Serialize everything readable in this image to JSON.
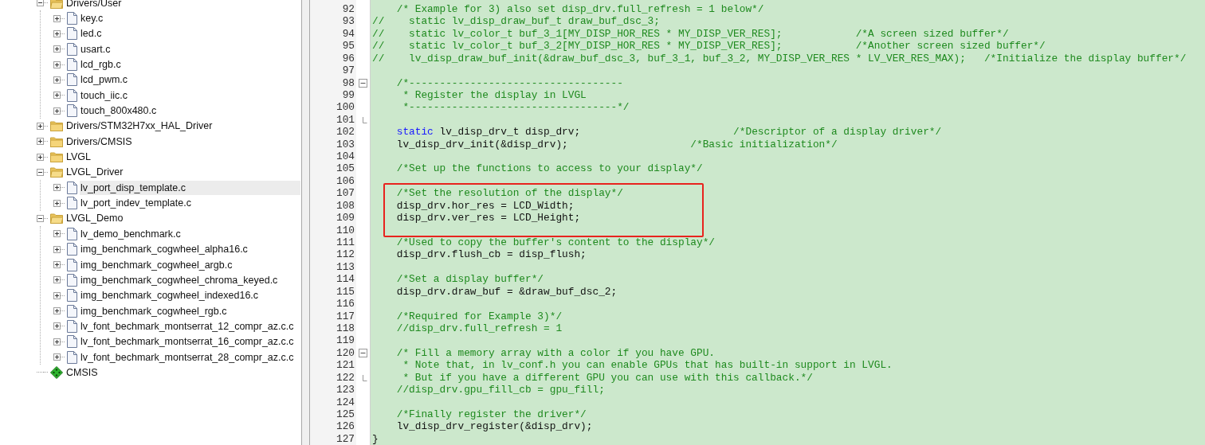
{
  "project_tree": {
    "items": [
      {
        "label": "Drivers/User",
        "kind": "folder",
        "expanded": true,
        "selected": false,
        "children": [
          {
            "label": "key.c",
            "kind": "file",
            "expanded": false,
            "selected": false
          },
          {
            "label": "led.c",
            "kind": "file",
            "expanded": false,
            "selected": false
          },
          {
            "label": "usart.c",
            "kind": "file",
            "expanded": false,
            "selected": false
          },
          {
            "label": "lcd_rgb.c",
            "kind": "file",
            "expanded": false,
            "selected": false
          },
          {
            "label": "lcd_pwm.c",
            "kind": "file",
            "expanded": false,
            "selected": false
          },
          {
            "label": "touch_iic.c",
            "kind": "file",
            "expanded": false,
            "selected": false
          },
          {
            "label": "touch_800x480.c",
            "kind": "file",
            "expanded": false,
            "selected": false
          }
        ]
      },
      {
        "label": "Drivers/STM32H7xx_HAL_Driver",
        "kind": "folder",
        "expanded": false,
        "selected": false
      },
      {
        "label": "Drivers/CMSIS",
        "kind": "folder",
        "expanded": false,
        "selected": false
      },
      {
        "label": "LVGL",
        "kind": "folder",
        "expanded": false,
        "selected": false
      },
      {
        "label": "LVGL_Driver",
        "kind": "folder",
        "expanded": true,
        "selected": false,
        "children": [
          {
            "label": "lv_port_disp_template.c",
            "kind": "file",
            "expanded": false,
            "selected": true
          },
          {
            "label": "lv_port_indev_template.c",
            "kind": "file",
            "expanded": false,
            "selected": false
          }
        ]
      },
      {
        "label": "LVGL_Demo",
        "kind": "folder",
        "expanded": true,
        "selected": false,
        "children": [
          {
            "label": "lv_demo_benchmark.c",
            "kind": "file",
            "expanded": false,
            "selected": false
          },
          {
            "label": "img_benchmark_cogwheel_alpha16.c",
            "kind": "file",
            "expanded": false,
            "selected": false
          },
          {
            "label": "img_benchmark_cogwheel_argb.c",
            "kind": "file",
            "expanded": false,
            "selected": false
          },
          {
            "label": "img_benchmark_cogwheel_chroma_keyed.c",
            "kind": "file",
            "expanded": false,
            "selected": false
          },
          {
            "label": "img_benchmark_cogwheel_indexed16.c",
            "kind": "file",
            "expanded": false,
            "selected": false
          },
          {
            "label": "img_benchmark_cogwheel_rgb.c",
            "kind": "file",
            "expanded": false,
            "selected": false
          },
          {
            "label": "lv_font_bechmark_montserrat_12_compr_az.c.c",
            "kind": "file",
            "expanded": false,
            "selected": false
          },
          {
            "label": "lv_font_bechmark_montserrat_16_compr_az.c.c",
            "kind": "file",
            "expanded": false,
            "selected": false
          },
          {
            "label": "lv_font_bechmark_montserrat_28_compr_az.c.c",
            "kind": "file",
            "expanded": false,
            "selected": false
          }
        ]
      },
      {
        "label": "CMSIS",
        "kind": "component",
        "selected": false
      }
    ]
  },
  "editor": {
    "lines": [
      {
        "number": "92",
        "segments": [
          {
            "kind": "comment",
            "text": "    /* Example for 3) also set disp_drv.full_refresh = 1 below*/"
          }
        ]
      },
      {
        "number": "93",
        "segments": [
          {
            "kind": "comment",
            "text": "//    static lv_disp_draw_buf_t draw_buf_dsc_3;"
          }
        ]
      },
      {
        "number": "94",
        "segments": [
          {
            "kind": "comment",
            "text": "//    static lv_color_t buf_3_1[MY_DISP_HOR_RES * MY_DISP_VER_RES];            /*A screen sized buffer*/"
          }
        ]
      },
      {
        "number": "95",
        "segments": [
          {
            "kind": "comment",
            "text": "//    static lv_color_t buf_3_2[MY_DISP_HOR_RES * MY_DISP_VER_RES];            /*Another screen sized buffer*/"
          }
        ]
      },
      {
        "number": "96",
        "segments": [
          {
            "kind": "comment",
            "text": "//    lv_disp_draw_buf_init(&draw_buf_dsc_3, buf_3_1, buf_3_2, MY_DISP_VER_RES * LV_VER_RES_MAX);   /*Initialize the display buffer*/"
          }
        ]
      },
      {
        "number": "97"
      },
      {
        "number": "98",
        "kind": "fold_start",
        "segments": [
          {
            "kind": "comment",
            "text": "    /*-----------------------------------"
          }
        ]
      },
      {
        "number": "99",
        "segments": [
          {
            "kind": "comment",
            "text": "     * Register the display in LVGL"
          }
        ]
      },
      {
        "number": "100",
        "segments": [
          {
            "kind": "comment",
            "text": "     *----------------------------------*/"
          }
        ]
      },
      {
        "number": "101",
        "kind": "fold_end"
      },
      {
        "number": "102",
        "segments": [
          {
            "kind": "keyword",
            "text": "    static"
          },
          {
            "kind": "code",
            "text": " lv_disp_drv_t disp_drv;                         "
          },
          {
            "kind": "comment",
            "text": "/*Descriptor of a display driver*/"
          }
        ]
      },
      {
        "number": "103",
        "segments": [
          {
            "kind": "code",
            "text": "    lv_disp_drv_init(&disp_drv);                    "
          },
          {
            "kind": "comment",
            "text": "/*Basic initialization*/"
          }
        ]
      },
      {
        "number": "104"
      },
      {
        "number": "105",
        "segments": [
          {
            "kind": "comment",
            "text": "    /*Set up the functions to access to your display*/"
          }
        ]
      },
      {
        "number": "106"
      },
      {
        "number": "107",
        "highlighted": true,
        "segments": [
          {
            "kind": "comment",
            "text": "    /*Set the resolution of the display*/"
          }
        ]
      },
      {
        "number": "108",
        "highlighted": true,
        "segments": [
          {
            "kind": "code",
            "text": "    disp_drv.hor_res = LCD_Width;"
          }
        ]
      },
      {
        "number": "109",
        "highlighted": true,
        "segments": [
          {
            "kind": "code",
            "text": "    disp_drv.ver_res = LCD_Height;"
          }
        ]
      },
      {
        "number": "110",
        "highlighted": true
      },
      {
        "number": "111",
        "segments": [
          {
            "kind": "comment",
            "text": "    /*Used to copy the buffer's content to the display*/"
          }
        ]
      },
      {
        "number": "112",
        "segments": [
          {
            "kind": "code",
            "text": "    disp_drv.flush_cb = disp_flush;"
          }
        ]
      },
      {
        "number": "113"
      },
      {
        "number": "114",
        "segments": [
          {
            "kind": "comment",
            "text": "    /*Set a display buffer*/"
          }
        ]
      },
      {
        "number": "115",
        "segments": [
          {
            "kind": "code",
            "text": "    disp_drv.draw_buf = &draw_buf_dsc_2;"
          }
        ]
      },
      {
        "number": "116"
      },
      {
        "number": "117",
        "segments": [
          {
            "kind": "comment",
            "text": "    /*Required for Example 3)*/"
          }
        ]
      },
      {
        "number": "118",
        "segments": [
          {
            "kind": "comment",
            "text": "    //disp_drv.full_refresh = 1"
          }
        ]
      },
      {
        "number": "119"
      },
      {
        "number": "120",
        "kind": "fold_start",
        "segments": [
          {
            "kind": "comment",
            "text": "    /* Fill a memory array with a color if you have GPU."
          }
        ]
      },
      {
        "number": "121",
        "segments": [
          {
            "kind": "comment",
            "text": "     * Note that, in lv_conf.h you can enable GPUs that has built-in support in LVGL."
          }
        ]
      },
      {
        "number": "122",
        "kind": "fold_end",
        "segments": [
          {
            "kind": "comment",
            "text": "     * But if you have a different GPU you can use with this callback.*/"
          }
        ]
      },
      {
        "number": "123",
        "segments": [
          {
            "kind": "comment",
            "text": "    //disp_drv.gpu_fill_cb = gpu_fill;"
          }
        ]
      },
      {
        "number": "124"
      },
      {
        "number": "125",
        "segments": [
          {
            "kind": "comment",
            "text": "    /*Finally register the driver*/"
          }
        ]
      },
      {
        "number": "126",
        "segments": [
          {
            "kind": "code",
            "text": "    lv_disp_drv_register(&disp_drv);"
          }
        ]
      },
      {
        "number": "127",
        "segments": [
          {
            "kind": "code",
            "text": "}"
          }
        ]
      }
    ]
  }
}
